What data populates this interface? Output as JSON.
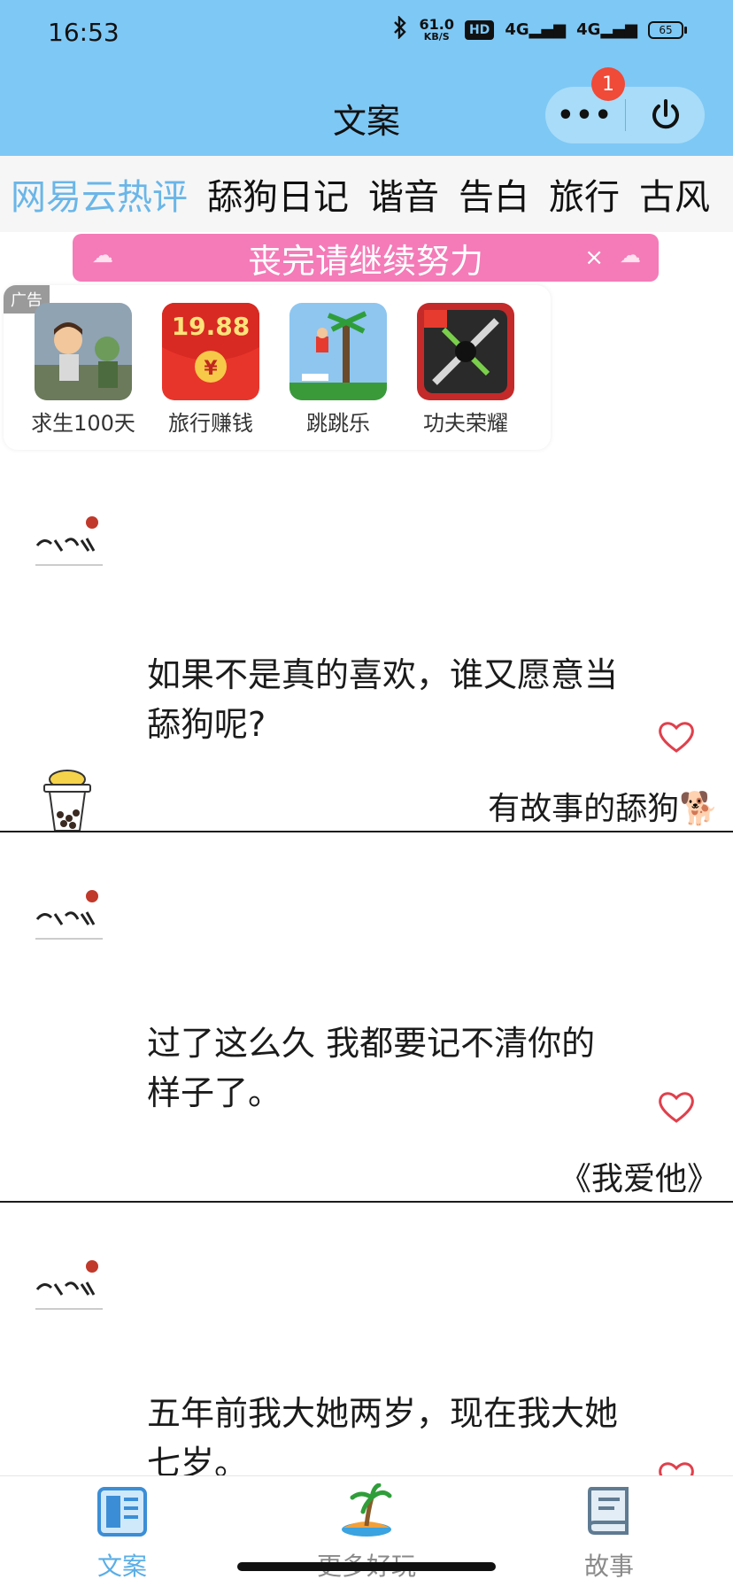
{
  "status_bar": {
    "time": "16:53",
    "bluetooth_icon": "bluetooth-icon",
    "net_speed_value": "61.0",
    "net_speed_unit": "KB/S",
    "hd_label": "HD",
    "signal_1": "4G",
    "signal_2": "4G",
    "battery": "65"
  },
  "header": {
    "title": "文案",
    "menu_dots": "•••",
    "notification_count": "1"
  },
  "tabs": [
    {
      "label": "网易云热评",
      "active": true
    },
    {
      "label": "舔狗日记",
      "active": false
    },
    {
      "label": "谐音",
      "active": false
    },
    {
      "label": "告白",
      "active": false
    },
    {
      "label": "旅行",
      "active": false
    },
    {
      "label": "古风",
      "active": false
    }
  ],
  "banner": {
    "text": "丧完请继续努力",
    "close": "×"
  },
  "ad": {
    "tag": "广告",
    "apps": [
      {
        "label": "求生100天",
        "icon": "survival-game-icon"
      },
      {
        "label": "旅行赚钱",
        "icon": "red-packet-icon",
        "amount": "19.88",
        "currency": "¥"
      },
      {
        "label": "跳跳乐",
        "icon": "jump-game-icon"
      },
      {
        "label": "功夫荣耀",
        "icon": "kungfu-game-icon"
      }
    ]
  },
  "cards": [
    {
      "quote_line1": "如果不是真的喜欢，谁又愿意当",
      "quote_line2": "舔狗呢?",
      "source": "有故事的舔狗🐕"
    },
    {
      "quote_line1": "过了这么久 我都要记不清你的",
      "quote_line2": "样子了。",
      "source": "《我爱他》"
    },
    {
      "quote_line1": "五年前我大她两岁，现在我大她",
      "quote_line2": "七岁。",
      "source": ""
    }
  ],
  "bottom_nav": [
    {
      "label": "文案",
      "icon": "newspaper-icon",
      "active": true
    },
    {
      "label": "更多好玩",
      "icon": "palm-island-icon",
      "active": false
    },
    {
      "label": "故事",
      "icon": "book-icon",
      "active": false
    }
  ],
  "colors": {
    "header_bg": "#7ec8f5",
    "tab_active": "#6ab6e8",
    "banner_bg": "#f47bb8",
    "heart": "#e0404c",
    "badge": "#f04a38"
  }
}
